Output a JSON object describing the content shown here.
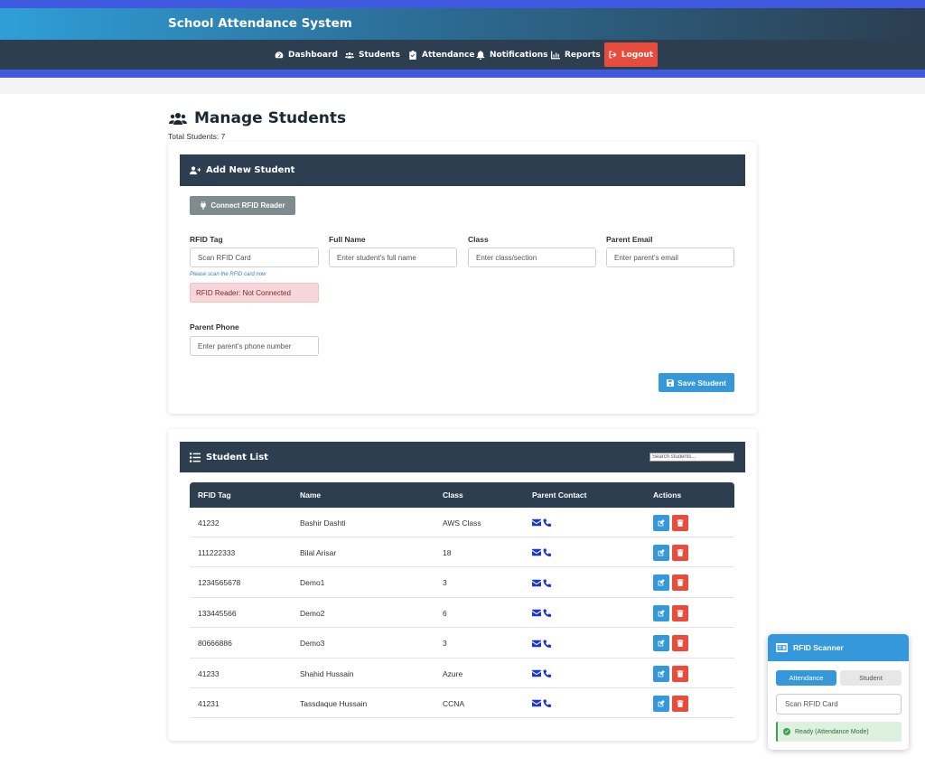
{
  "app": {
    "title": "School Attendance System"
  },
  "nav": {
    "items": [
      {
        "label": "Dashboard",
        "icon": "dashboard-icon"
      },
      {
        "label": "Students",
        "icon": "users-icon"
      },
      {
        "label": "Attendance",
        "icon": "clipboard-check-icon"
      },
      {
        "label": "Notifications",
        "icon": "bell-icon"
      },
      {
        "label": "Reports",
        "icon": "chart-icon"
      }
    ],
    "logout": "Logout"
  },
  "page": {
    "title": "Manage Students",
    "total": "Total Students: 7"
  },
  "add_form": {
    "heading": "Add New Student",
    "connect_button": "Connect RFID Reader",
    "fields": {
      "rfid": {
        "label": "RFID Tag",
        "placeholder": "Scan RFID Card"
      },
      "name": {
        "label": "Full Name",
        "placeholder": "Enter student's full name"
      },
      "class": {
        "label": "Class",
        "placeholder": "Enter class/section"
      },
      "email": {
        "label": "Parent Email",
        "placeholder": "Enter parent's email"
      },
      "phone": {
        "label": "Parent Phone",
        "placeholder": "Enter parent's phone number"
      }
    },
    "hint": "Please scan the RFID card now",
    "reader_status": "RFID Reader: Not Connected",
    "save_button": "Save Student"
  },
  "student_list": {
    "heading": "Student List",
    "search_placeholder": "Search students...",
    "columns": [
      "RFID Tag",
      "Name",
      "Class",
      "Parent Contact",
      "Actions"
    ],
    "rows": [
      {
        "rfid": "41232",
        "name": "Bashir Dashti",
        "class": "AWS Class"
      },
      {
        "rfid": "111222333",
        "name": "Bilal Arisar",
        "class": "18"
      },
      {
        "rfid": "1234565678",
        "name": "Demo1",
        "class": "3"
      },
      {
        "rfid": "133445566",
        "name": "Demo2",
        "class": "6"
      },
      {
        "rfid": "80666886",
        "name": "Demo3",
        "class": "3"
      },
      {
        "rfid": "41233",
        "name": "Shahid Hussain",
        "class": "Azure"
      },
      {
        "rfid": "41231",
        "name": "Tassdaque Hussain",
        "class": "CCNA"
      }
    ]
  },
  "scanner": {
    "title": "RFID Scanner",
    "tabs": [
      "Attendance",
      "Student"
    ],
    "placeholder": "Scan RFID Card",
    "status": "Ready (Attendance Mode)"
  },
  "colors": {
    "navbar": "#2c3e50",
    "accent_blue": "#3498db",
    "danger": "#e74c3c",
    "top_band": "#3f5ae0"
  }
}
